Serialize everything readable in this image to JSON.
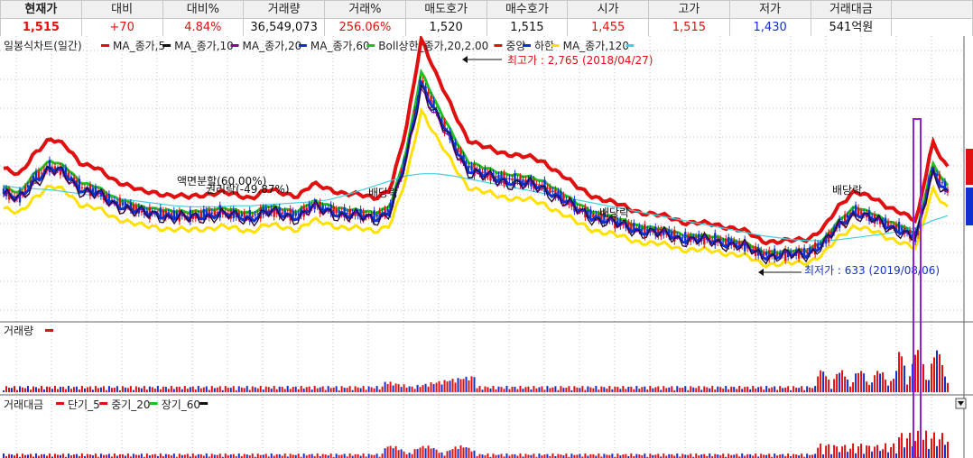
{
  "quote_bar": {
    "headers": [
      "현재가",
      "대비",
      "대비%",
      "거래량",
      "거래%",
      "매도호가",
      "매수호가",
      "시가",
      "고가",
      "저가",
      "거래대금"
    ],
    "values": [
      "1,515",
      "+70",
      "4.84%",
      "36,549,073",
      "256.06%",
      "1,520",
      "1,515",
      "1,455",
      "1,515",
      "1,430",
      "541억원"
    ],
    "value_colors": [
      "#e01010",
      "#e01010",
      "#e01010",
      "#111111",
      "#e01010",
      "#111111",
      "#111111",
      "#e01010",
      "#e01010",
      "#1030d0",
      "#111111"
    ]
  },
  "price_panel": {
    "title": "일봉식차트(일간)",
    "legend": [
      {
        "label": "MA_종가,5",
        "color": "#e01010"
      },
      {
        "label": "MA_종가,10",
        "color": "#111111"
      },
      {
        "label": "MA_종가,20",
        "color": "#8000a0"
      },
      {
        "label": "MA_종가,60",
        "color": "#1030d0"
      },
      {
        "label": "Boll상한_종가,20,2.00",
        "color": "#20c020"
      },
      {
        "label": "중앙",
        "color": "#e01010"
      },
      {
        "label": "하한",
        "color": "#1030d0"
      },
      {
        "label": "MA_종가,120",
        "color": "#ffe000"
      },
      {
        "label": "",
        "color": "#40d0e0"
      }
    ],
    "annotations": {
      "high": "최고가 : 2,765 (2018/04/27)",
      "low": "최저가 : 633 (2019/08/06)",
      "split": "액면분할(60.00%)",
      "split2": "권리락(-49.87%)",
      "div1": "배당락",
      "div2": "배당락",
      "div3": "배당락"
    }
  },
  "volume_panel": {
    "title": "거래량",
    "legend_color": "#e01010"
  },
  "amount_panel": {
    "title": "거래대금",
    "legend": [
      {
        "label": "단기_5",
        "color": "#e01010"
      },
      {
        "label": "중기_20",
        "color": "#e01010"
      },
      {
        "label": "장기_60",
        "color": "#20c020"
      },
      {
        "label": "",
        "color": "#111111"
      }
    ]
  },
  "colors": {
    "up": "#e01010",
    "down": "#1030d0",
    "grid": "#b8b8c8",
    "highlight_box": "#9020d0"
  },
  "chart_data": {
    "type": "line",
    "title": "일봉식차트(일간)",
    "y_high": {
      "label": "최고가",
      "value": 2765,
      "date": "2018/04/27"
    },
    "y_low": {
      "label": "최저가",
      "value": 633,
      "date": "2019/08/06"
    },
    "series": [
      {
        "name": "MA_종가,5",
        "values": [
          1550,
          1480,
          1700,
          1820,
          1760,
          1600,
          1550,
          1450,
          1400,
          1330,
          1320,
          1300,
          1280,
          1310,
          1330,
          1300,
          1280,
          1350,
          1320,
          1300,
          1400,
          1360,
          1320,
          1300,
          1280,
          1360,
          1900,
          2765,
          2400,
          2100,
          1820,
          1750,
          1700,
          1680,
          1650,
          1600,
          1500,
          1380,
          1300,
          1250,
          1200,
          1150,
          1120,
          1100,
          1050,
          1040,
          1030,
          1000,
          960,
          880,
          870,
          880,
          900,
          1000,
          1200,
          1350,
          1280,
          1200,
          1150,
          1050,
          1800,
          1560
        ]
      },
      {
        "name": "MA_종가,120",
        "values": [
          1500,
          1480,
          1470,
          1460,
          1440,
          1420,
          1400,
          1380,
          1360,
          1340,
          1320,
          1300,
          1290,
          1290,
          1290,
          1300,
          1300,
          1310,
          1320,
          1330,
          1340,
          1360,
          1400,
          1450,
          1500,
          1550,
          1600,
          1620,
          1620,
          1600,
          1570,
          1540,
          1510,
          1480,
          1450,
          1420,
          1390,
          1360,
          1330,
          1300,
          1270,
          1240,
          1210,
          1180,
          1150,
          1120,
          1090,
          1060,
          1030,
          1000,
          980,
          960,
          950,
          950,
          960,
          980,
          1000,
          1020,
          1050,
          1080,
          1150,
          1200
        ]
      }
    ]
  }
}
